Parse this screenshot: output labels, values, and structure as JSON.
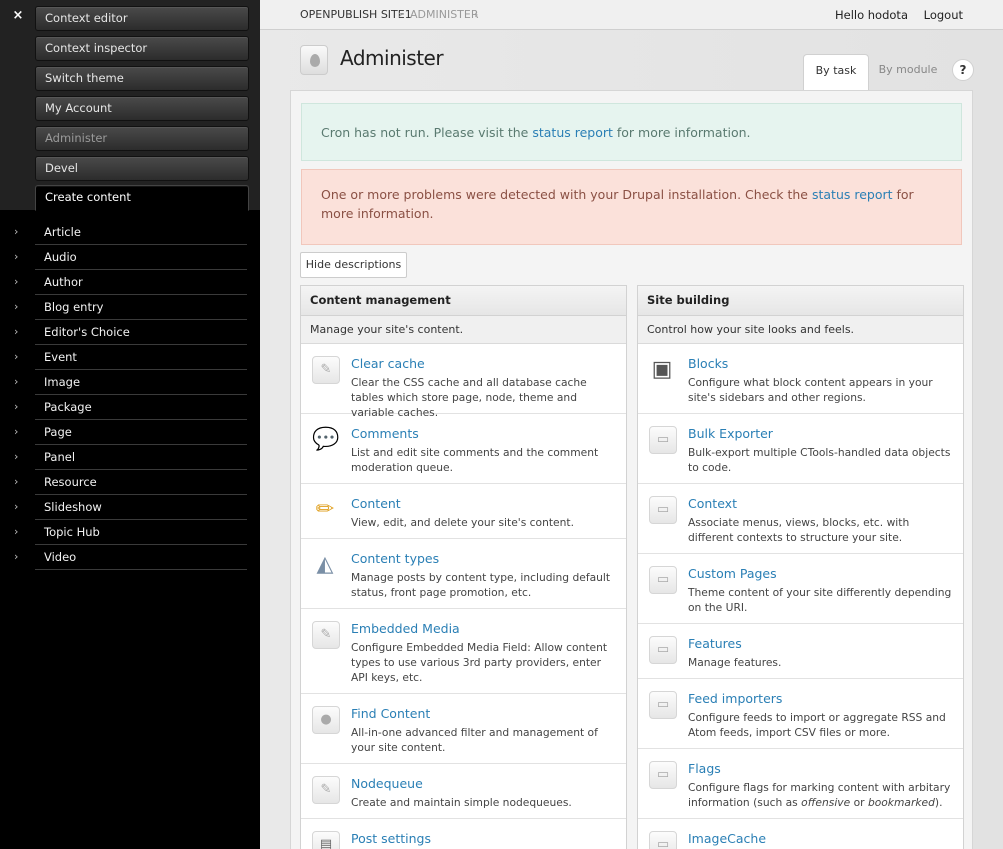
{
  "sidebar": {
    "close_glyph": "×",
    "menu": [
      {
        "label": "Context editor"
      },
      {
        "label": "Context inspector"
      },
      {
        "label": "Switch theme"
      },
      {
        "label": "My Account"
      },
      {
        "label": "Administer"
      },
      {
        "label": "Devel"
      },
      {
        "label": "Create content"
      }
    ],
    "create_items": [
      {
        "label": "Article"
      },
      {
        "label": "Audio"
      },
      {
        "label": "Author"
      },
      {
        "label": "Blog entry"
      },
      {
        "label": "Editor's Choice"
      },
      {
        "label": "Event"
      },
      {
        "label": "Image"
      },
      {
        "label": "Package"
      },
      {
        "label": "Page"
      },
      {
        "label": "Panel"
      },
      {
        "label": "Resource"
      },
      {
        "label": "Slideshow"
      },
      {
        "label": "Topic Hub"
      },
      {
        "label": "Video"
      }
    ],
    "chevron_glyph": "›"
  },
  "topbar": {
    "site": "OPENPUBLISH SITE1",
    "admin": "ADMINISTER",
    "sep": "›",
    "hello": "Hello hodota",
    "logout": "Logout"
  },
  "page": {
    "title": "Administer",
    "tab_task": "By task",
    "tab_module": "By module",
    "help": "?"
  },
  "messages": {
    "cron_pre": "Cron has not run. Please visit the ",
    "cron_link": "status report",
    "cron_post": " for more information.",
    "problem_pre": "One or more problems were detected with your Drupal installation. Check the ",
    "problem_link": "status report",
    "problem_post": " for more information."
  },
  "hide_descriptions": "Hide descriptions",
  "columns": {
    "left": {
      "title": "Content management",
      "description": "Manage your site's content.",
      "items": [
        {
          "title": "Clear cache",
          "desc": "Clear the CSS cache and all database cache tables which store page, node, theme and variable caches.",
          "icon": "pencil-icon"
        },
        {
          "title": "Comments",
          "desc": "List and edit site comments and the comment moderation queue.",
          "icon": "comment-bubble-icon"
        },
        {
          "title": "Content",
          "desc": "View, edit, and delete your site's content.",
          "icon": "pencil-color-icon"
        },
        {
          "title": "Content types",
          "desc": "Manage posts by content type, including default status, front page promotion, etc.",
          "icon": "shapes-icon"
        },
        {
          "title": "Embedded Media",
          "desc": "Configure Embedded Media Field: Allow content types to use various 3rd party providers, enter API keys, etc.",
          "icon": "pencil-icon"
        },
        {
          "title": "Find Content",
          "desc": "All-in-one advanced filter and management of your site content.",
          "icon": "user-icon"
        },
        {
          "title": "Nodequeue",
          "desc": "Create and maintain simple nodequeues.",
          "icon": "pencil-icon"
        },
        {
          "title": "Post settings",
          "desc": "",
          "icon": "document-icon"
        }
      ]
    },
    "right": {
      "title": "Site building",
      "description": "Control how your site looks and feels.",
      "items": [
        {
          "title": "Blocks",
          "desc": "Configure what block content appears in your site's sidebars and other regions.",
          "icon": "blocks-icon"
        },
        {
          "title": "Bulk Exporter",
          "desc": "Bulk-export multiple CTools-handled data objects to code.",
          "icon": "box-icon"
        },
        {
          "title": "Context",
          "desc": "Associate menus, views, blocks, etc. with different contexts to structure your site.",
          "icon": "box-icon"
        },
        {
          "title": "Custom Pages",
          "desc": "Theme content of your site differently depending on the URI.",
          "icon": "box-icon"
        },
        {
          "title": "Features",
          "desc": "Manage features.",
          "icon": "box-icon"
        },
        {
          "title": "Feed importers",
          "desc": "Configure feeds to import or aggregate RSS and Atom feeds, import CSV files or more.",
          "icon": "box-icon"
        },
        {
          "title": "Flags",
          "desc_pre": "Configure flags for marking content with arbitary information (such as ",
          "desc_em1": "offensive",
          "desc_mid": " or ",
          "desc_em2": "bookmarked",
          "desc_post": ").",
          "icon": "box-icon"
        },
        {
          "title": "ImageCache",
          "desc": "",
          "icon": "box-icon"
        }
      ]
    }
  },
  "colors": {
    "link": "#2a7fb5",
    "cron_bg": "#e6f4ef",
    "problem_bg": "#fbe1da"
  }
}
